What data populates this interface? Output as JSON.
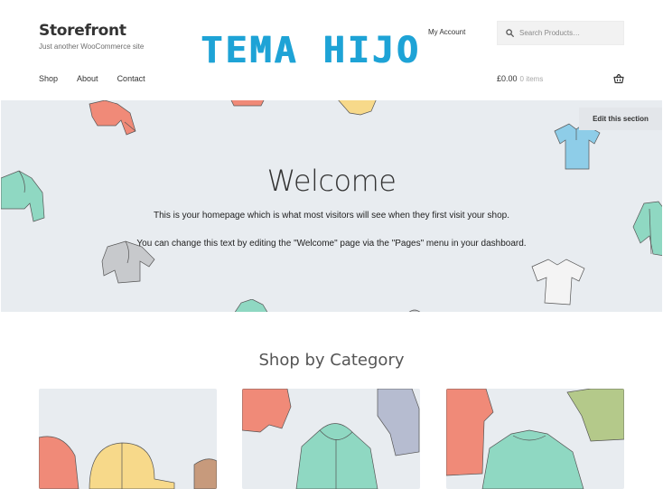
{
  "header": {
    "site_title": "Storefront",
    "site_description": "Just another WooCommerce site",
    "logo_text": "TEMA HIJO",
    "my_account": "My Account",
    "search_placeholder": "Search Products…"
  },
  "nav": {
    "items": [
      {
        "label": "Shop"
      },
      {
        "label": "About"
      },
      {
        "label": "Contact"
      }
    ]
  },
  "cart": {
    "total": "£0.00",
    "count": "0 items"
  },
  "hero": {
    "edit_label": "Edit this section",
    "title": "Welcome",
    "paragraph_1": "This is your homepage which is what most visitors will see when they first visit your shop.",
    "paragraph_2": "You can change this text by editing the \"Welcome\" page via the \"Pages\" menu in your dashboard."
  },
  "shop_by_category": {
    "title": "Shop by Category"
  },
  "colors": {
    "brand_blue": "#1ea3d6",
    "hero_bg": "#e8ecf0",
    "coral": "#f08a78",
    "mint": "#8fd8c2",
    "yellow": "#f7d98a",
    "blue": "#8ecde8",
    "gray": "#c7c9cc"
  }
}
